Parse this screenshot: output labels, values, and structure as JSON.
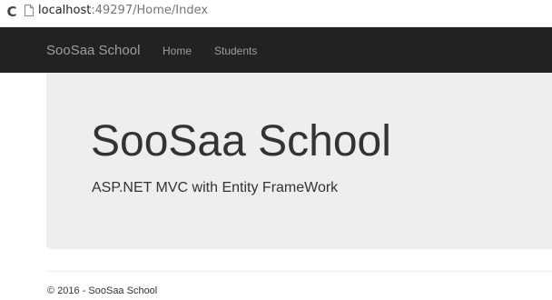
{
  "browser": {
    "reload_icon": "reload-icon",
    "page_icon": "page-icon",
    "url_host": "localhost",
    "url_rest": ":49297/Home/Index"
  },
  "navbar": {
    "background": "#222222",
    "brand": "SooSaa School",
    "links": [
      {
        "label": "Home"
      },
      {
        "label": "Students"
      }
    ]
  },
  "jumbotron": {
    "background": "#eeeeee",
    "title": "SooSaa School",
    "subtitle": "ASP.NET MVC with Entity FrameWork"
  },
  "footer": {
    "text": "© 2016 - SooSaa School"
  }
}
